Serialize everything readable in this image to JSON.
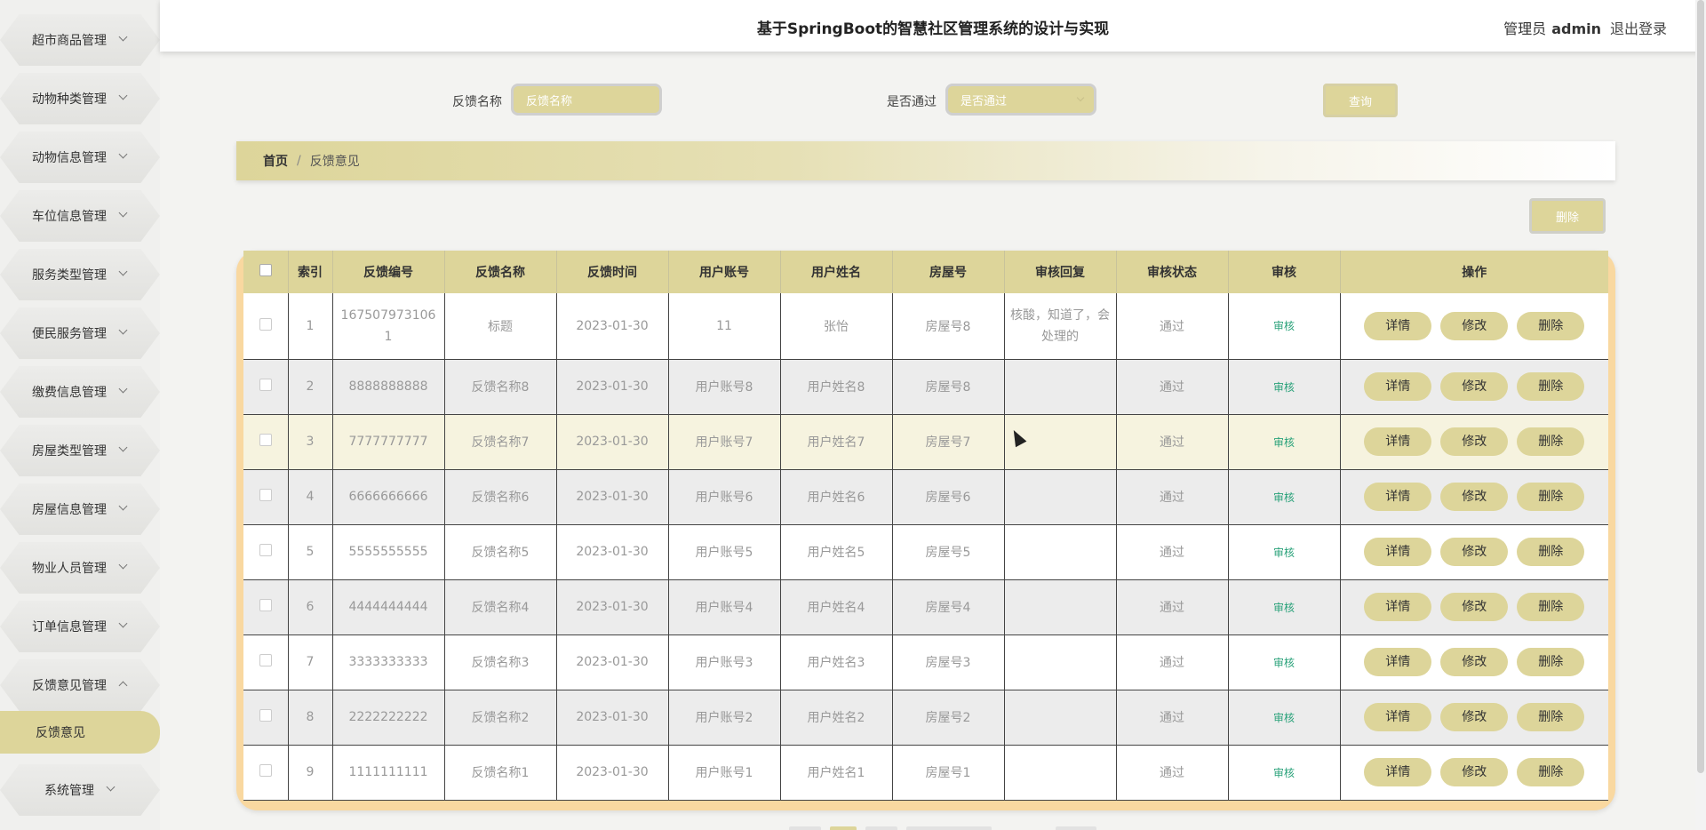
{
  "header": {
    "title": "基于SpringBoot的智慧社区管理系统的设计与实现",
    "role": "管理员",
    "username": "admin",
    "logout": "退出登录"
  },
  "sidebar": {
    "items": [
      {
        "label": "超市商品管理"
      },
      {
        "label": "动物种类管理"
      },
      {
        "label": "动物信息管理"
      },
      {
        "label": "车位信息管理"
      },
      {
        "label": "服务类型管理"
      },
      {
        "label": "便民服务管理"
      },
      {
        "label": "缴费信息管理"
      },
      {
        "label": "房屋类型管理"
      },
      {
        "label": "房屋信息管理"
      },
      {
        "label": "物业人员管理"
      },
      {
        "label": "订单信息管理"
      },
      {
        "label": "反馈意见管理"
      },
      {
        "label": "系统管理"
      }
    ],
    "active_sub": "反馈意见"
  },
  "search": {
    "name_label": "反馈名称",
    "name_placeholder": "反馈名称",
    "pass_label": "是否通过",
    "pass_placeholder": "是否通过",
    "query_button": "查询"
  },
  "breadcrumb": {
    "home": "首页",
    "separator": "/",
    "current": "反馈意见"
  },
  "actions": {
    "delete_button": "删除"
  },
  "table": {
    "headers": [
      "索引",
      "反馈编号",
      "反馈名称",
      "反馈时间",
      "用户账号",
      "用户姓名",
      "房屋号",
      "审核回复",
      "审核状态",
      "审核",
      "操作"
    ],
    "op_labels": {
      "detail": "详情",
      "edit": "修改",
      "delete": "删除"
    },
    "rows": [
      {
        "index": "1",
        "code": "1675079731061",
        "name": "标题",
        "time": "2023-01-30",
        "account": "11",
        "user": "张怡",
        "house": "房屋号8",
        "reply": "核酸，知道了，会处理的",
        "status": "通过",
        "audit": "审核"
      },
      {
        "index": "2",
        "code": "8888888888",
        "name": "反馈名称8",
        "time": "2023-01-30",
        "account": "用户账号8",
        "user": "用户姓名8",
        "house": "房屋号8",
        "reply": "",
        "status": "通过",
        "audit": "审核"
      },
      {
        "index": "3",
        "code": "7777777777",
        "name": "反馈名称7",
        "time": "2023-01-30",
        "account": "用户账号7",
        "user": "用户姓名7",
        "house": "房屋号7",
        "reply": "",
        "status": "通过",
        "audit": "审核"
      },
      {
        "index": "4",
        "code": "6666666666",
        "name": "反馈名称6",
        "time": "2023-01-30",
        "account": "用户账号6",
        "user": "用户姓名6",
        "house": "房屋号6",
        "reply": "",
        "status": "通过",
        "audit": "审核"
      },
      {
        "index": "5",
        "code": "5555555555",
        "name": "反馈名称5",
        "time": "2023-01-30",
        "account": "用户账号5",
        "user": "用户姓名5",
        "house": "房屋号5",
        "reply": "",
        "status": "通过",
        "audit": "审核"
      },
      {
        "index": "6",
        "code": "4444444444",
        "name": "反馈名称4",
        "time": "2023-01-30",
        "account": "用户账号4",
        "user": "用户姓名4",
        "house": "房屋号4",
        "reply": "",
        "status": "通过",
        "audit": "审核"
      },
      {
        "index": "7",
        "code": "3333333333",
        "name": "反馈名称3",
        "time": "2023-01-30",
        "account": "用户账号3",
        "user": "用户姓名3",
        "house": "房屋号3",
        "reply": "",
        "status": "通过",
        "audit": "审核"
      },
      {
        "index": "8",
        "code": "2222222222",
        "name": "反馈名称2",
        "time": "2023-01-30",
        "account": "用户账号2",
        "user": "用户姓名2",
        "house": "房屋号2",
        "reply": "",
        "status": "通过",
        "audit": "审核"
      },
      {
        "index": "9",
        "code": "1111111111",
        "name": "反馈名称1",
        "time": "2023-01-30",
        "account": "用户账号1",
        "user": "用户姓名1",
        "house": "房屋号1",
        "reply": "",
        "status": "通过",
        "audit": "审核"
      }
    ]
  },
  "colors": {
    "accent": "#ddd59a",
    "table_border": "#f9d8a0",
    "audit_link": "#2aa27a"
  }
}
